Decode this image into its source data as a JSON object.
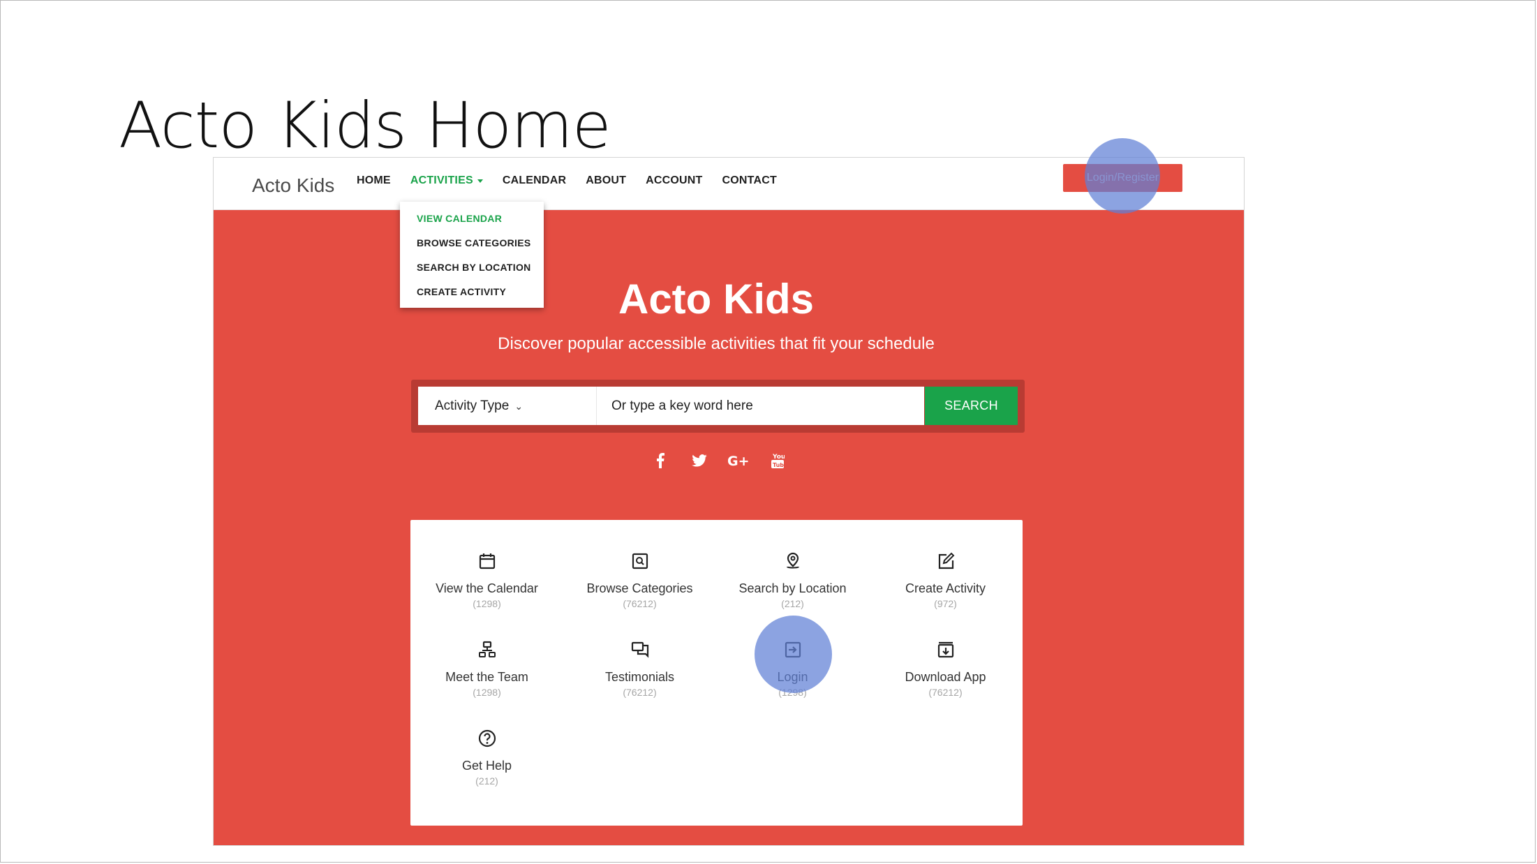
{
  "slide": {
    "title": "Acto Kids Home"
  },
  "nav": {
    "brand": "Acto Kids",
    "items": [
      {
        "label": "HOME"
      },
      {
        "label": "ACTIVITIES"
      },
      {
        "label": "CALENDAR"
      },
      {
        "label": "ABOUT"
      },
      {
        "label": "ACCOUNT"
      },
      {
        "label": "CONTACT"
      }
    ],
    "login_label": "Login/Register",
    "active_color": "#1aa34a"
  },
  "dropdown": {
    "items": [
      {
        "label": "VIEW CALENDAR"
      },
      {
        "label": "BROWSE CATEGORIES"
      },
      {
        "label": "SEARCH BY LOCATION"
      },
      {
        "label": "CREATE ACTIVITY"
      }
    ]
  },
  "hero": {
    "title": "Acto Kids",
    "subtitle": "Discover popular accessible activities that fit your schedule",
    "background": "#e44d42"
  },
  "search": {
    "type_label": "Activity Type",
    "placeholder": "Or type a key word here",
    "button_label": "SEARCH",
    "button_color": "#1aa34a"
  },
  "socials": [
    {
      "icon": "facebook-icon"
    },
    {
      "icon": "twitter-icon"
    },
    {
      "icon": "google-plus-icon"
    },
    {
      "icon": "youtube-icon"
    }
  ],
  "tiles": [
    {
      "label": "View the Calendar",
      "count": "(1298)",
      "icon": "calendar-icon"
    },
    {
      "label": "Browse Categories",
      "count": "(76212)",
      "icon": "category-search-icon"
    },
    {
      "label": "Search by Location",
      "count": "(212)",
      "icon": "location-pin-icon"
    },
    {
      "label": "Create Activity",
      "count": "(972)",
      "icon": "edit-icon"
    },
    {
      "label": "Meet the Team",
      "count": "(1298)",
      "icon": "team-icon"
    },
    {
      "label": "Testimonials",
      "count": "(76212)",
      "icon": "chat-icon"
    },
    {
      "label": "Login",
      "count": "(1298)",
      "icon": "login-icon"
    },
    {
      "label": "Download App",
      "count": "(76212)",
      "icon": "download-icon"
    },
    {
      "label": "Get Help",
      "count": "(212)",
      "icon": "help-icon"
    }
  ],
  "highlight_color": "#6080d6"
}
